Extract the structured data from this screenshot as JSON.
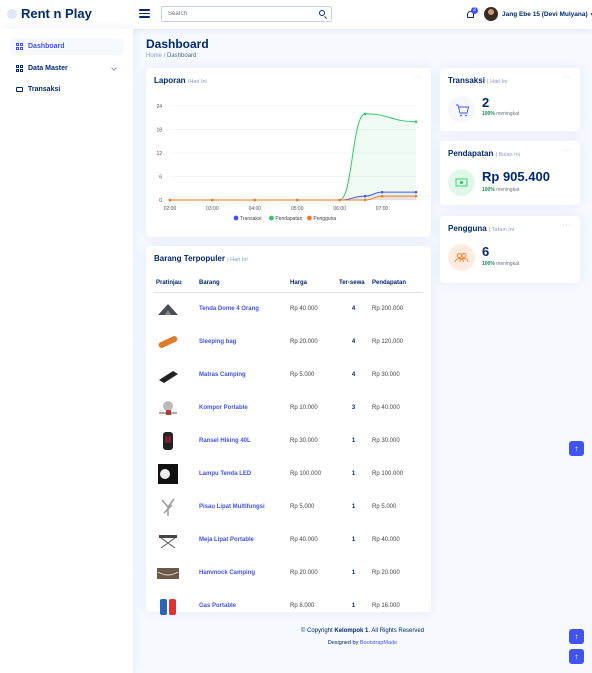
{
  "app": {
    "brand": "Rent n Play"
  },
  "header": {
    "search_placeholder": "Search",
    "notif_count": "2",
    "user_name": "Jang Ebe 15 (Devi Mulyana)"
  },
  "sidebar": {
    "items": [
      {
        "label": "Dashboard",
        "active": true
      },
      {
        "label": "Data Master",
        "active": false
      },
      {
        "label": "Transaksi",
        "active": false
      }
    ]
  },
  "page": {
    "title": "Dashboard",
    "breadcrumb": {
      "home": "Home",
      "sep": "/",
      "current": "Dashboard"
    }
  },
  "report": {
    "title": "Laporan",
    "period": "/Hari Ini",
    "dots": "···"
  },
  "chart_data": {
    "type": "area",
    "x": [
      "02:00",
      "03:00",
      "04:00",
      "05:00",
      "06:00",
      "07:00"
    ],
    "ylim": [
      0,
      24
    ],
    "y_ticks": [
      "0",
      "6",
      "12",
      "18",
      "24"
    ],
    "series": [
      {
        "name": "Transaksi",
        "color": "#4154f1",
        "points": [
          [
            2.0,
            0
          ],
          [
            3.0,
            0
          ],
          [
            4.0,
            0
          ],
          [
            5.0,
            0
          ],
          [
            6.0,
            0
          ],
          [
            6.6,
            1
          ],
          [
            7.0,
            2
          ],
          [
            7.8,
            2
          ]
        ]
      },
      {
        "name": "Pendapatan",
        "color": "#2eca6a",
        "points": [
          [
            2.0,
            0
          ],
          [
            3.0,
            0
          ],
          [
            4.0,
            0
          ],
          [
            5.0,
            0
          ],
          [
            6.0,
            0
          ],
          [
            6.6,
            22
          ],
          [
            7.8,
            20
          ]
        ]
      },
      {
        "name": "Pengguna",
        "color": "#ff771d",
        "points": [
          [
            2.0,
            0
          ],
          [
            3.0,
            0
          ],
          [
            4.0,
            0
          ],
          [
            5.0,
            0
          ],
          [
            6.0,
            0
          ],
          [
            6.6,
            0
          ],
          [
            7.0,
            1
          ],
          [
            7.8,
            1
          ]
        ]
      }
    ]
  },
  "popular": {
    "title": "Barang Terpopuler",
    "period": "| Hari Ini",
    "headers": [
      "Pratinjau",
      "Barang",
      "Harga",
      "Ter-sewa",
      "Pendapatan"
    ],
    "rows": [
      {
        "name": "Tenda Dome 4 Orang",
        "price": "Rp 40.000",
        "qty": "4",
        "income": "Rp 200.000"
      },
      {
        "name": "Sleeping bag",
        "price": "Rp 20.000",
        "qty": "4",
        "income": "Rp 120.000"
      },
      {
        "name": "Matras Camping",
        "price": "Rp 5.000",
        "qty": "4",
        "income": "Rp 30.000"
      },
      {
        "name": "Kompor Portable",
        "price": "Rp 10.000",
        "qty": "3",
        "income": "Rp 40.000"
      },
      {
        "name": "Ransel Hiking 40L",
        "price": "Rp 30.000",
        "qty": "1",
        "income": "Rp 30.000"
      },
      {
        "name": "Lampu Tenda LED",
        "price": "Rp 100.000",
        "qty": "1",
        "income": "Rp 100.000"
      },
      {
        "name": "Pisau Lipat Multifungsi",
        "price": "Rp 5.000",
        "qty": "1",
        "income": "Rp 5.000"
      },
      {
        "name": "Meja Lipat Portable",
        "price": "Rp 40.000",
        "qty": "1",
        "income": "Rp 40.000"
      },
      {
        "name": "Hammock Camping",
        "price": "Rp 20.000",
        "qty": "1",
        "income": "Rp 20.000"
      },
      {
        "name": "Gas Portable",
        "price": "Rp 8.000",
        "qty": "1",
        "income": "Rp 16.000"
      }
    ]
  },
  "stats": {
    "transaksi": {
      "title": "Transaksi",
      "period": "| Hari Ini",
      "value": "2",
      "pct": "100%",
      "note": "meningkat"
    },
    "pendapatan": {
      "title": "Pendapatan",
      "period": "| Bulan Ini",
      "value": "Rp 905.400",
      "pct": "100%",
      "note": "meningkat"
    },
    "pengguna": {
      "title": "Pengguna",
      "period": "| Tahun Ini",
      "value": "6",
      "pct": "100%",
      "note": "meningkat"
    }
  },
  "footer": {
    "copy_prefix": "© Copyright ",
    "copy_brand": "Kelompok 1",
    "copy_suffix": ". All Rights Reserved",
    "designed_prefix": "Designed by ",
    "designed_link": "BootstrapMade"
  },
  "colors": {
    "primary": "#4154f1",
    "navy": "#012970",
    "green": "#2eca6a",
    "orange": "#ff771d"
  }
}
